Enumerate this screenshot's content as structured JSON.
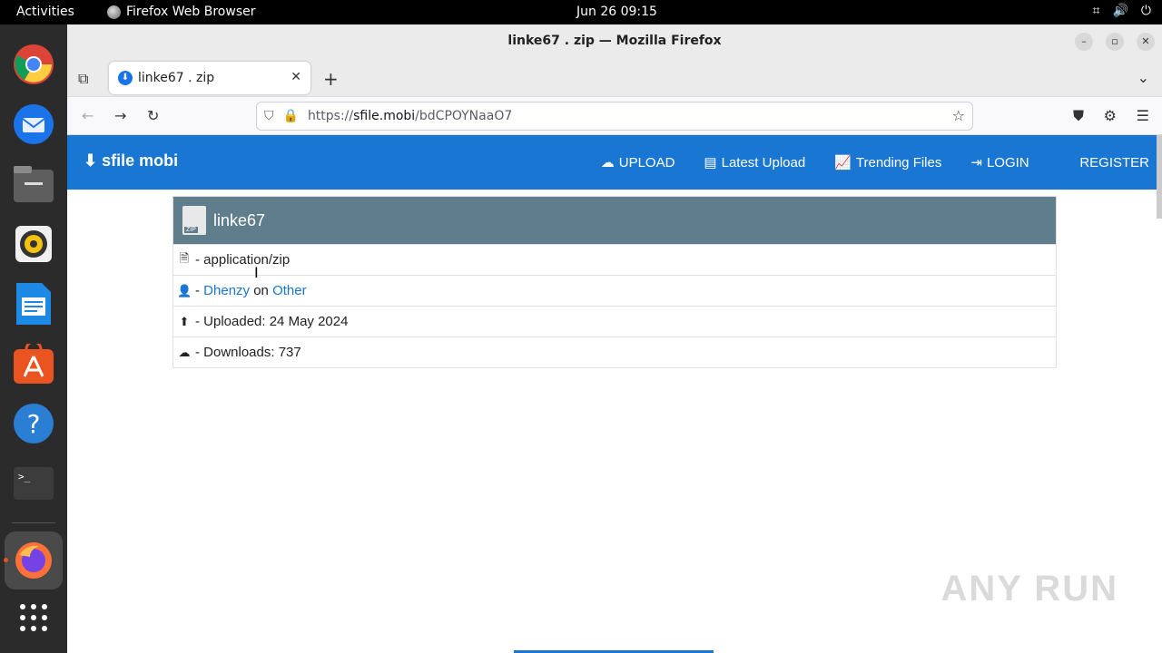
{
  "topbar": {
    "activities": "Activities",
    "app_name": "Firefox Web Browser",
    "clock": "Jun 26  09:15"
  },
  "window": {
    "title": "linke67 . zip — Mozilla Firefox"
  },
  "tab": {
    "title": "linke67 . zip"
  },
  "urlbar": {
    "prefix": "https://",
    "domain": "sfile.mobi",
    "path": "/bdCPOYNaaO7"
  },
  "site": {
    "brand": "sfile mobi",
    "menu": {
      "upload": "UPLOAD",
      "latest": "Latest Upload",
      "trending": "Trending Files",
      "login": "LOGIN",
      "register": "REGISTER"
    }
  },
  "file": {
    "name": "linke67",
    "zip_badge": "ZIP",
    "type": "- application/zip",
    "uploader_prefix": "- ",
    "uploader": "Dhenzy",
    "on": " on ",
    "category": "Other",
    "uploaded": "- Uploaded: 24 May 2024",
    "downloads": "- Downloads: 737"
  },
  "watermark": "ANY RUN",
  "colors": {
    "nav_blue": "#1976d2",
    "file_header": "#607d8b"
  }
}
